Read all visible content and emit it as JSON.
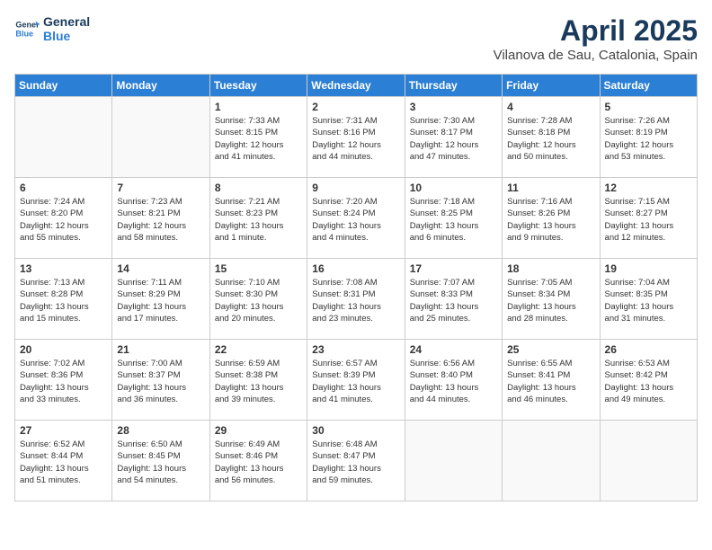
{
  "logo": {
    "line1": "General",
    "line2": "Blue"
  },
  "title": "April 2025",
  "location": "Vilanova de Sau, Catalonia, Spain",
  "weekdays": [
    "Sunday",
    "Monday",
    "Tuesday",
    "Wednesday",
    "Thursday",
    "Friday",
    "Saturday"
  ],
  "weeks": [
    [
      {
        "day": "",
        "info": ""
      },
      {
        "day": "",
        "info": ""
      },
      {
        "day": "1",
        "info": "Sunrise: 7:33 AM\nSunset: 8:15 PM\nDaylight: 12 hours\nand 41 minutes."
      },
      {
        "day": "2",
        "info": "Sunrise: 7:31 AM\nSunset: 8:16 PM\nDaylight: 12 hours\nand 44 minutes."
      },
      {
        "day": "3",
        "info": "Sunrise: 7:30 AM\nSunset: 8:17 PM\nDaylight: 12 hours\nand 47 minutes."
      },
      {
        "day": "4",
        "info": "Sunrise: 7:28 AM\nSunset: 8:18 PM\nDaylight: 12 hours\nand 50 minutes."
      },
      {
        "day": "5",
        "info": "Sunrise: 7:26 AM\nSunset: 8:19 PM\nDaylight: 12 hours\nand 53 minutes."
      }
    ],
    [
      {
        "day": "6",
        "info": "Sunrise: 7:24 AM\nSunset: 8:20 PM\nDaylight: 12 hours\nand 55 minutes."
      },
      {
        "day": "7",
        "info": "Sunrise: 7:23 AM\nSunset: 8:21 PM\nDaylight: 12 hours\nand 58 minutes."
      },
      {
        "day": "8",
        "info": "Sunrise: 7:21 AM\nSunset: 8:23 PM\nDaylight: 13 hours\nand 1 minute."
      },
      {
        "day": "9",
        "info": "Sunrise: 7:20 AM\nSunset: 8:24 PM\nDaylight: 13 hours\nand 4 minutes."
      },
      {
        "day": "10",
        "info": "Sunrise: 7:18 AM\nSunset: 8:25 PM\nDaylight: 13 hours\nand 6 minutes."
      },
      {
        "day": "11",
        "info": "Sunrise: 7:16 AM\nSunset: 8:26 PM\nDaylight: 13 hours\nand 9 minutes."
      },
      {
        "day": "12",
        "info": "Sunrise: 7:15 AM\nSunset: 8:27 PM\nDaylight: 13 hours\nand 12 minutes."
      }
    ],
    [
      {
        "day": "13",
        "info": "Sunrise: 7:13 AM\nSunset: 8:28 PM\nDaylight: 13 hours\nand 15 minutes."
      },
      {
        "day": "14",
        "info": "Sunrise: 7:11 AM\nSunset: 8:29 PM\nDaylight: 13 hours\nand 17 minutes."
      },
      {
        "day": "15",
        "info": "Sunrise: 7:10 AM\nSunset: 8:30 PM\nDaylight: 13 hours\nand 20 minutes."
      },
      {
        "day": "16",
        "info": "Sunrise: 7:08 AM\nSunset: 8:31 PM\nDaylight: 13 hours\nand 23 minutes."
      },
      {
        "day": "17",
        "info": "Sunrise: 7:07 AM\nSunset: 8:33 PM\nDaylight: 13 hours\nand 25 minutes."
      },
      {
        "day": "18",
        "info": "Sunrise: 7:05 AM\nSunset: 8:34 PM\nDaylight: 13 hours\nand 28 minutes."
      },
      {
        "day": "19",
        "info": "Sunrise: 7:04 AM\nSunset: 8:35 PM\nDaylight: 13 hours\nand 31 minutes."
      }
    ],
    [
      {
        "day": "20",
        "info": "Sunrise: 7:02 AM\nSunset: 8:36 PM\nDaylight: 13 hours\nand 33 minutes."
      },
      {
        "day": "21",
        "info": "Sunrise: 7:00 AM\nSunset: 8:37 PM\nDaylight: 13 hours\nand 36 minutes."
      },
      {
        "day": "22",
        "info": "Sunrise: 6:59 AM\nSunset: 8:38 PM\nDaylight: 13 hours\nand 39 minutes."
      },
      {
        "day": "23",
        "info": "Sunrise: 6:57 AM\nSunset: 8:39 PM\nDaylight: 13 hours\nand 41 minutes."
      },
      {
        "day": "24",
        "info": "Sunrise: 6:56 AM\nSunset: 8:40 PM\nDaylight: 13 hours\nand 44 minutes."
      },
      {
        "day": "25",
        "info": "Sunrise: 6:55 AM\nSunset: 8:41 PM\nDaylight: 13 hours\nand 46 minutes."
      },
      {
        "day": "26",
        "info": "Sunrise: 6:53 AM\nSunset: 8:42 PM\nDaylight: 13 hours\nand 49 minutes."
      }
    ],
    [
      {
        "day": "27",
        "info": "Sunrise: 6:52 AM\nSunset: 8:44 PM\nDaylight: 13 hours\nand 51 minutes."
      },
      {
        "day": "28",
        "info": "Sunrise: 6:50 AM\nSunset: 8:45 PM\nDaylight: 13 hours\nand 54 minutes."
      },
      {
        "day": "29",
        "info": "Sunrise: 6:49 AM\nSunset: 8:46 PM\nDaylight: 13 hours\nand 56 minutes."
      },
      {
        "day": "30",
        "info": "Sunrise: 6:48 AM\nSunset: 8:47 PM\nDaylight: 13 hours\nand 59 minutes."
      },
      {
        "day": "",
        "info": ""
      },
      {
        "day": "",
        "info": ""
      },
      {
        "day": "",
        "info": ""
      }
    ]
  ]
}
